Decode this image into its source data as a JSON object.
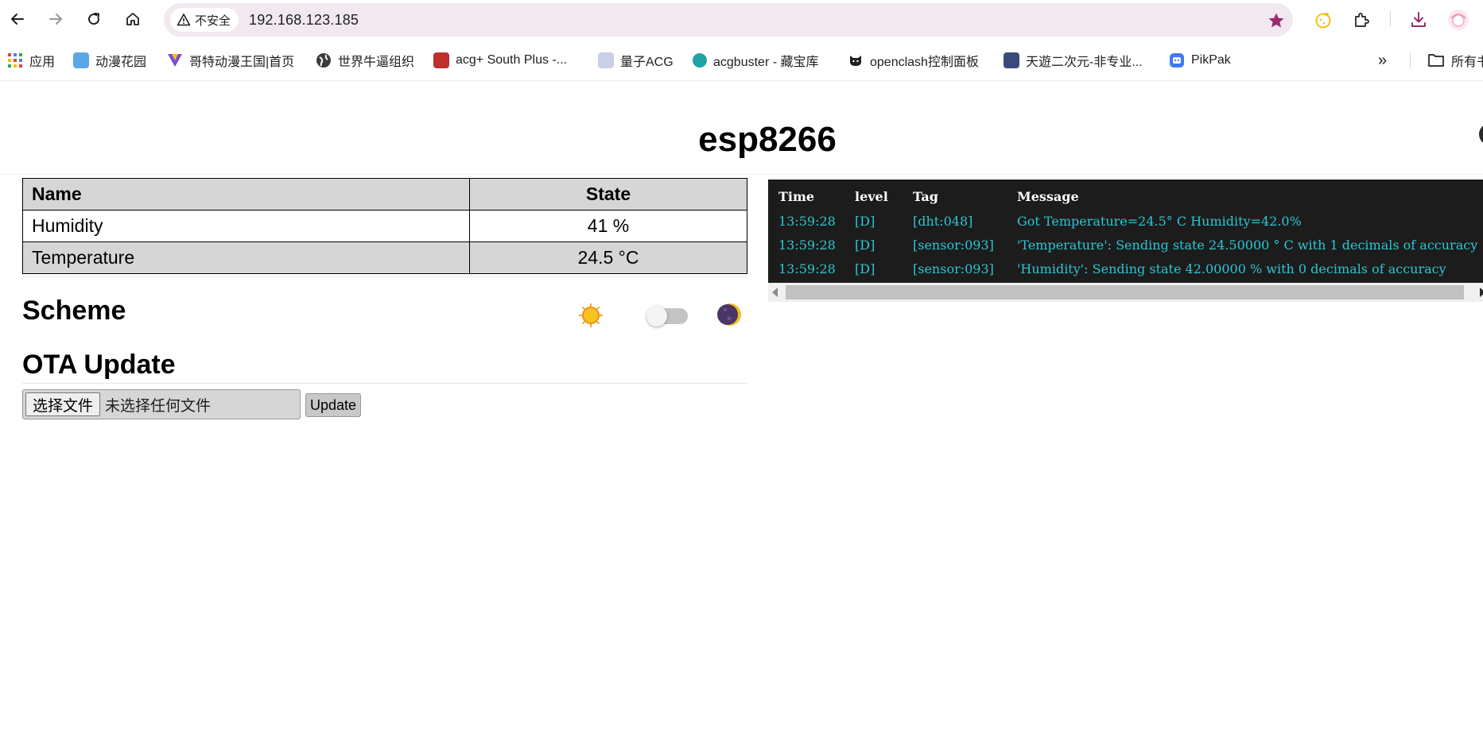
{
  "browser": {
    "security_label": "不安全",
    "url": "192.168.123.185",
    "accent_color": "#9b2b6b",
    "bookmarks": [
      {
        "label": "应用",
        "icon": "apps-grid-icon"
      },
      {
        "label": "动漫花园",
        "icon": "dmhy-icon"
      },
      {
        "label": "哥特动漫王国|首页",
        "icon": "gothic-anime-icon"
      },
      {
        "label": "世界牛逼组织",
        "icon": "globe-icon"
      },
      {
        "label": "acg+ South Plus -...",
        "icon": "south-plus-icon"
      },
      {
        "label": "量子ACG",
        "icon": "quantum-acg-icon"
      },
      {
        "label": "acgbuster - 藏宝库",
        "icon": "acgbuster-icon"
      },
      {
        "label": "openclash控制面板",
        "icon": "github-cat-icon"
      },
      {
        "label": "天遊二次元-非专业...",
        "icon": "tianyou-icon"
      },
      {
        "label": "PikPak",
        "icon": "pikpak-icon"
      }
    ],
    "more_bookmarks": "»",
    "all_bookmarks_label": "所有书签"
  },
  "page": {
    "title": "esp8266",
    "table": {
      "headers": [
        "Name",
        "State"
      ],
      "rows": [
        {
          "name": "Humidity",
          "state": "41 %"
        },
        {
          "name": "Temperature",
          "state": "24.5 °C"
        }
      ]
    },
    "scheme_title": "Scheme",
    "scheme_dark_enabled": false,
    "ota_title": "OTA Update",
    "file_button_label": "选择文件",
    "file_status": "未选择任何文件",
    "update_button_label": "Update"
  },
  "log": {
    "headers": [
      "Time",
      "level",
      "Tag",
      "Message"
    ],
    "lines": [
      {
        "time": "13:59:28",
        "level": "[D]",
        "tag": "[dht:048]",
        "message": "Got Temperature=24.5° C Humidity=42.0%"
      },
      {
        "time": "13:59:28",
        "level": "[D]",
        "tag": "[sensor:093]",
        "message": "'Temperature': Sending state 24.50000 ° C with 1 decimals of accuracy"
      },
      {
        "time": "13:59:28",
        "level": "[D]",
        "tag": "[sensor:093]",
        "message": "'Humidity': Sending state 42.00000 % with 0 decimals of accuracy"
      }
    ],
    "text_color": "#2ec5d3",
    "background_color": "#1c1c1c"
  }
}
